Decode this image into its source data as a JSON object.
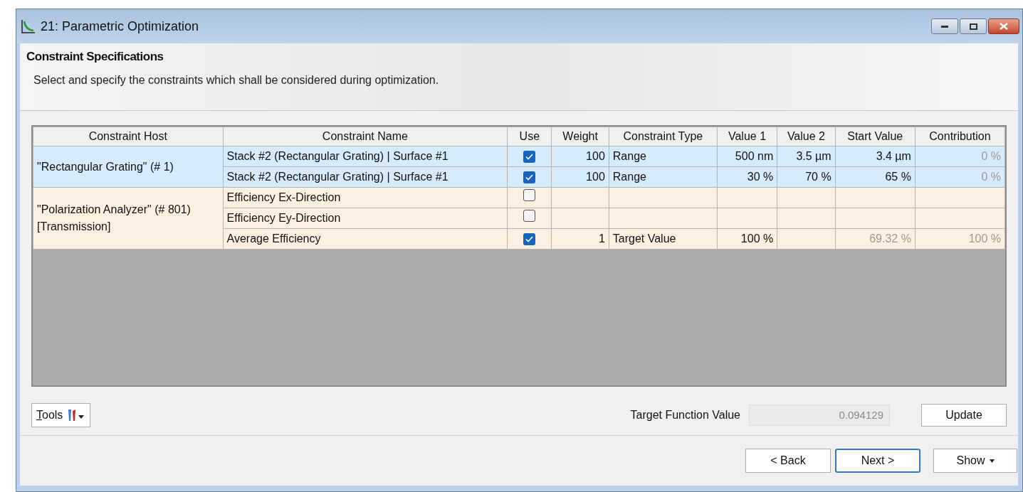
{
  "window": {
    "title": "21: Parametric Optimization"
  },
  "header": {
    "title": "Constraint Specifications",
    "description": "Select and specify the constraints which shall be considered during optimization."
  },
  "table": {
    "columns": [
      "Constraint Host",
      "Constraint Name",
      "Use",
      "Weight",
      "Constraint Type",
      "Value 1",
      "Value 2",
      "Start Value",
      "Contribution"
    ],
    "groups": [
      {
        "host": "\"Rectangular Grating\" (# 1)",
        "color": "#d6ebfb",
        "rows": [
          {
            "name": "Stack #2 (Rectangular Grating) | Surface #1",
            "checked": true,
            "weight": "100",
            "type": "Range",
            "value_1": "500 nm",
            "value_2": "3.5 µm",
            "start_value": {
              "text": "3.4 µm",
              "disabled": false
            },
            "contribution": {
              "text": "0 %",
              "disabled": true
            }
          },
          {
            "name": "Stack #2 (Rectangular Grating) | Surface #1",
            "checked": true,
            "weight": "100",
            "type": "Range",
            "value_1": "30 %",
            "value_2": "70 %",
            "start_value": {
              "text": "65 %",
              "disabled": false
            },
            "contribution": {
              "text": "0 %",
              "disabled": true
            }
          }
        ]
      },
      {
        "host": "\"Polarization Analyzer\" (# 801) [Transmission]",
        "color": "#fdf0e0",
        "rows": [
          {
            "name": "Efficiency Ex-Direction",
            "checked": false
          },
          {
            "name": "Efficiency Ey-Direction",
            "checked": false
          },
          {
            "name": "Average Efficiency",
            "checked": true,
            "weight": "1",
            "type": "Target Value",
            "value_1": "100 %",
            "start_value": {
              "text": "69.32 %",
              "disabled": true
            },
            "contribution": {
              "text": "100 %",
              "disabled": true
            }
          }
        ]
      }
    ]
  },
  "tools_button": "Tools",
  "target_function": {
    "label": "Target Function Value",
    "value": "0.094129"
  },
  "update_button": "Update",
  "buttons": [
    "< Back",
    "Next >"
  ],
  "show_button": "Show"
}
